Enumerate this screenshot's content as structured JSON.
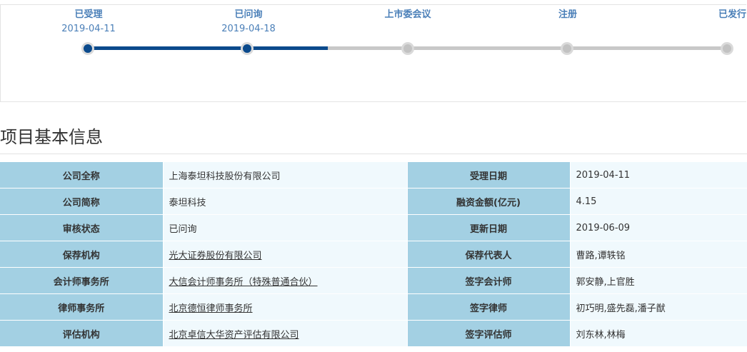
{
  "timeline": {
    "steps": [
      {
        "label": "已受理",
        "date": "2019-04-11",
        "status": "done"
      },
      {
        "label": "已问询",
        "date": "2019-04-18",
        "status": "done"
      },
      {
        "label": "上市委会议",
        "date": "",
        "status": "todo"
      },
      {
        "label": "注册",
        "date": "",
        "status": "todo"
      },
      {
        "label": "已发行",
        "date": "",
        "status": "todo"
      }
    ],
    "colors": {
      "done": "#0b4a8c",
      "todo": "#c2c2c2",
      "label": "#4a7fb8"
    }
  },
  "section": {
    "title": "项目基本信息"
  },
  "info": {
    "rows": [
      {
        "l1": "公司全称",
        "v1": "上海泰坦科技股份有限公司",
        "l2": "受理日期",
        "v2": "2019-04-11"
      },
      {
        "l1": "公司简称",
        "v1": "泰坦科技",
        "l2": "融资金额(亿元)",
        "v2": "4.15"
      },
      {
        "l1": "审核状态",
        "v1": "已问询",
        "l2": "更新日期",
        "v2": "2019-06-09"
      },
      {
        "l1": "保荐机构",
        "v1": "光大证券股份有限公司",
        "l2": "保荐代表人",
        "v2": "曹路,谭轶铭"
      },
      {
        "l1": "会计师事务所",
        "v1": "大信会计师事务所（特殊普通合伙）",
        "l2": "签字会计师",
        "v2": "郭安静,上官胜"
      },
      {
        "l1": "律师事务所",
        "v1": "北京德恒律师事务所",
        "l2": "签字律师",
        "v2": "初巧明,盛先磊,潘子猷"
      },
      {
        "l1": "评估机构",
        "v1": "北京卓信大华资产评估有限公司",
        "l2": "签字评估师",
        "v2": "刘东林,林梅"
      }
    ]
  },
  "colors": {
    "label_bg": "#a3d0e3",
    "value_bg": "#f0f9fd"
  }
}
